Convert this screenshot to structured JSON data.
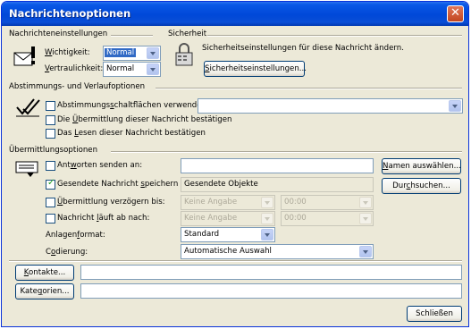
{
  "window": {
    "title": "Nachrichtenoptionen",
    "close_glyph": "✕"
  },
  "message_settings": {
    "heading": "Nachrichteneinstellungen",
    "importance": {
      "label_pre": "",
      "label_acc": "W",
      "label_post": "ichtigkeit:",
      "value": "Normal"
    },
    "sensitivity": {
      "label_pre": "",
      "label_acc": "V",
      "label_post": "ertraulichkeit:",
      "value": "Normal"
    }
  },
  "security": {
    "heading": "Sicherheit",
    "text": "Sicherheitseinstellungen für diese Nachricht ändern.",
    "button": {
      "pre": "",
      "acc": "S",
      "post": "icherheitseinstellungen..."
    }
  },
  "voting": {
    "heading": "Abstimmungs- und Verlaufoptionen",
    "use_voting": {
      "pre": "Abstimmungs",
      "acc": "s",
      "post": "chaltflächen verwenden:",
      "checked": false,
      "value": ""
    },
    "request_delivery": {
      "pre": "Die ",
      "acc": "Ü",
      "post": "bermittlung dieser Nachricht bestätigen",
      "checked": false
    },
    "request_read": {
      "pre": "Das ",
      "acc": "L",
      "post": "esen dieser Nachricht bestätigen",
      "checked": false
    }
  },
  "delivery": {
    "heading": "Übermittlungsoptionen",
    "replies_to": {
      "pre": "Ant",
      "acc": "w",
      "post": "orten senden an:",
      "checked": false,
      "value": ""
    },
    "select_names": {
      "pre": "",
      "acc": "N",
      "post": "amen auswählen..."
    },
    "save_sent": {
      "pre": "Gesendete Nachricht ",
      "acc": "s",
      "post": "peichern in:",
      "checked": true,
      "value": "Gesendete Objekte"
    },
    "browse": {
      "pre": "Dur",
      "acc": "c",
      "post": "hsuchen..."
    },
    "delay": {
      "pre": "",
      "acc": "Ü",
      "post": "bermittlung verzögern bis:",
      "checked": false,
      "date": "Keine Angabe",
      "time": "00:00"
    },
    "expires": {
      "pre": "Nachricht ",
      "acc": "l",
      "post": "äuft ab nach:",
      "checked": false,
      "date": "Keine Angabe",
      "time": "00:00"
    },
    "attachment_format": {
      "pre": "Anlagen",
      "acc": "f",
      "post": "ormat:",
      "value": "Standard"
    },
    "encoding": {
      "pre": "C",
      "acc": "o",
      "post": "dierung:",
      "value": "Automatische Auswahl"
    }
  },
  "contacts": {
    "pre": "",
    "acc": "K",
    "post": "ontakte...",
    "value": ""
  },
  "categories": {
    "pre": "Kate",
    "acc": "g",
    "post": "orien...",
    "value": ""
  },
  "close_button": {
    "label": "Schließen"
  }
}
